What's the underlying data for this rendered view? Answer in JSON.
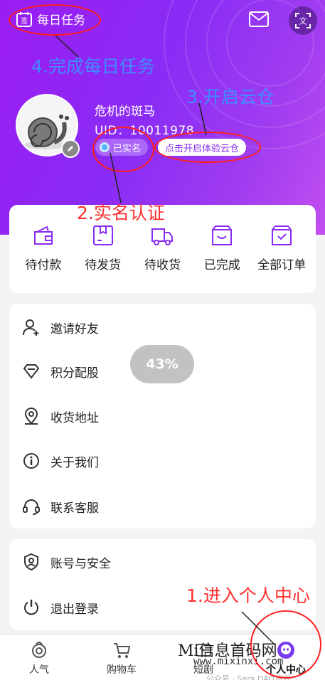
{
  "header": {
    "checkin_label": "每日任务",
    "checkin_icon_glyph": "签",
    "translate_icon_glyph": "文"
  },
  "profile": {
    "username": "危机的斑马",
    "uid": "UID：10011978",
    "verified_label": "已实名",
    "cloud_label": "点击开启体验云仓"
  },
  "annotations": {
    "step4": "4.完成每日任务",
    "step3": "3.开启云仓",
    "step2": "2.实名认证",
    "step1": "1.进入个人中心"
  },
  "orders": [
    {
      "label": "待付款",
      "icon": "wallet-icon"
    },
    {
      "label": "待发货",
      "icon": "box-icon"
    },
    {
      "label": "待收货",
      "icon": "truck-icon"
    },
    {
      "label": "已完成",
      "icon": "done-box-icon"
    },
    {
      "label": "全部订单",
      "icon": "all-orders-icon"
    }
  ],
  "menu1": [
    {
      "label": "邀请好友",
      "icon": "invite-user-icon"
    },
    {
      "label": "积分配股",
      "icon": "diamond-icon"
    },
    {
      "label": "收货地址",
      "icon": "location-icon"
    },
    {
      "label": "关于我们",
      "icon": "info-icon"
    },
    {
      "label": "联系客服",
      "icon": "headset-icon"
    }
  ],
  "menu2": [
    {
      "label": "账号与安全",
      "icon": "shield-icon"
    },
    {
      "label": "退出登录",
      "icon": "power-icon"
    }
  ],
  "progress_overlay": "43%",
  "tabbar": [
    {
      "label": "人气",
      "icon": "popularity-icon"
    },
    {
      "label": "购物车",
      "icon": "cart-icon"
    },
    {
      "label": "短剧",
      "icon": "drama-icon"
    },
    {
      "label": "个人中心",
      "icon": "profile-icon",
      "active": true
    }
  ],
  "watermark": {
    "line1": "Mi信息首码网",
    "line2": "www.mixinxi.com",
    "footer": "公众号 · Sara DAO官方"
  },
  "colors": {
    "brand_purple": "#8a2cf5",
    "annotation_red": "#ff3030",
    "annotation_blue": "#3f8cff"
  }
}
